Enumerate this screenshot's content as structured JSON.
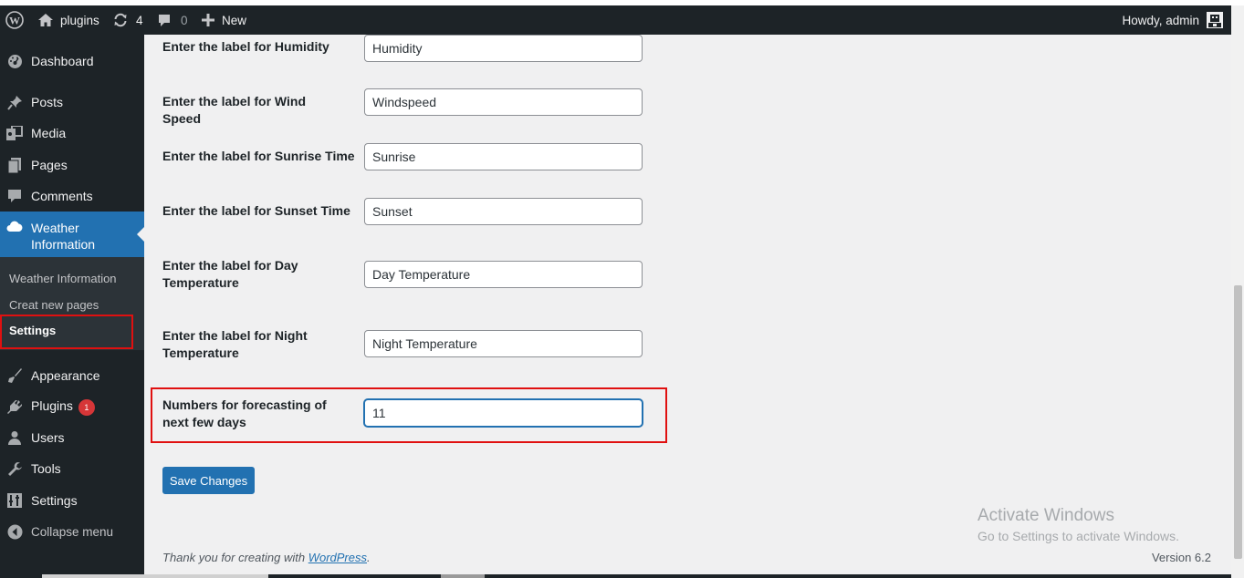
{
  "admin_bar": {
    "site_name": "plugins",
    "updates_count": "4",
    "comments_count": "0",
    "new_label": "New",
    "greeting": "Howdy, admin"
  },
  "sidebar": {
    "items": [
      {
        "label": "Dashboard",
        "icon": "dashboard-icon"
      },
      {
        "label": "Posts",
        "icon": "pushpin-icon"
      },
      {
        "label": "Media",
        "icon": "media-icon"
      },
      {
        "label": "Pages",
        "icon": "pages-icon"
      },
      {
        "label": "Comments",
        "icon": "comment-icon"
      },
      {
        "label": "Weather Information",
        "icon": "cloud-icon"
      },
      {
        "label": "Appearance",
        "icon": "paintbrush-icon"
      },
      {
        "label": "Plugins",
        "icon": "plugin-icon",
        "badge": "1"
      },
      {
        "label": "Users",
        "icon": "user-icon"
      },
      {
        "label": "Tools",
        "icon": "wrench-icon"
      },
      {
        "label": "Settings",
        "icon": "settings-icon"
      },
      {
        "label": "Collapse menu",
        "icon": "collapse-icon"
      }
    ],
    "weather_label_line1": "Weather",
    "weather_label_line2": "Information",
    "submenu": [
      "Weather Information",
      "Creat new pages",
      "Settings"
    ]
  },
  "form": {
    "rows": [
      {
        "label": "Enter the label for Humidity",
        "value": "Humidity"
      },
      {
        "label": "Enter the label for Wind Speed",
        "value": "Windspeed"
      },
      {
        "label": "Enter the label for Sunrise Time",
        "value": "Sunrise"
      },
      {
        "label": "Enter the label for Sunset Time",
        "value": "Sunset"
      },
      {
        "label": "Enter the label for Day Temperature",
        "value": "Day Temperature"
      },
      {
        "label": "Enter the label for Night Temperature",
        "value": "Night Temperature"
      },
      {
        "label": "Numbers for forecasting of next few days",
        "value": "11"
      }
    ],
    "save_label": "Save Changes"
  },
  "footer": {
    "thanks_prefix": "Thank you for creating with ",
    "thanks_link": "WordPress",
    "thanks_suffix": ".",
    "version": "Version 6.2"
  },
  "watermark": {
    "title": "Activate Windows",
    "subtitle": "Go to Settings to activate Windows."
  },
  "colors": {
    "admin_bg": "#1d2327",
    "accent": "#2271b1",
    "highlight": "#e01010"
  }
}
